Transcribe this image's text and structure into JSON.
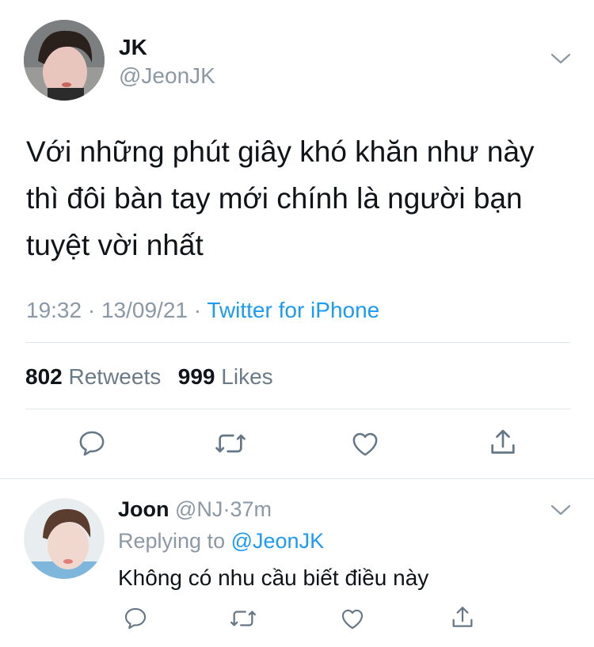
{
  "main_tweet": {
    "display_name": "JK",
    "handle": "@JeonJK",
    "text_lines": [
      "Với những phút giây khó khăn như này",
      "thì đôi bàn tay mới chính là người bạn",
      "tuyệt vời nhất"
    ],
    "time": "19:32",
    "separator": "·",
    "date": "13/09/21",
    "source": "Twitter for iPhone",
    "retweet_count": "802",
    "retweet_label": "Retweets",
    "like_count": "999",
    "like_label": "Likes"
  },
  "reply_tweet": {
    "display_name": "Joon",
    "handle": "@NJ",
    "separator": "·",
    "time_ago": "37m",
    "replying_prefix": "Replying to",
    "replying_handle": "@JeonJK",
    "text": "Không có nhu cầu biết điều này"
  },
  "colors": {
    "accent": "#1d9bf0",
    "secondary_text": "#8b98a5",
    "divider": "#e1e6ea"
  },
  "icons": [
    "chevron-down-icon",
    "reply-icon",
    "retweet-icon",
    "like-icon",
    "share-icon"
  ]
}
